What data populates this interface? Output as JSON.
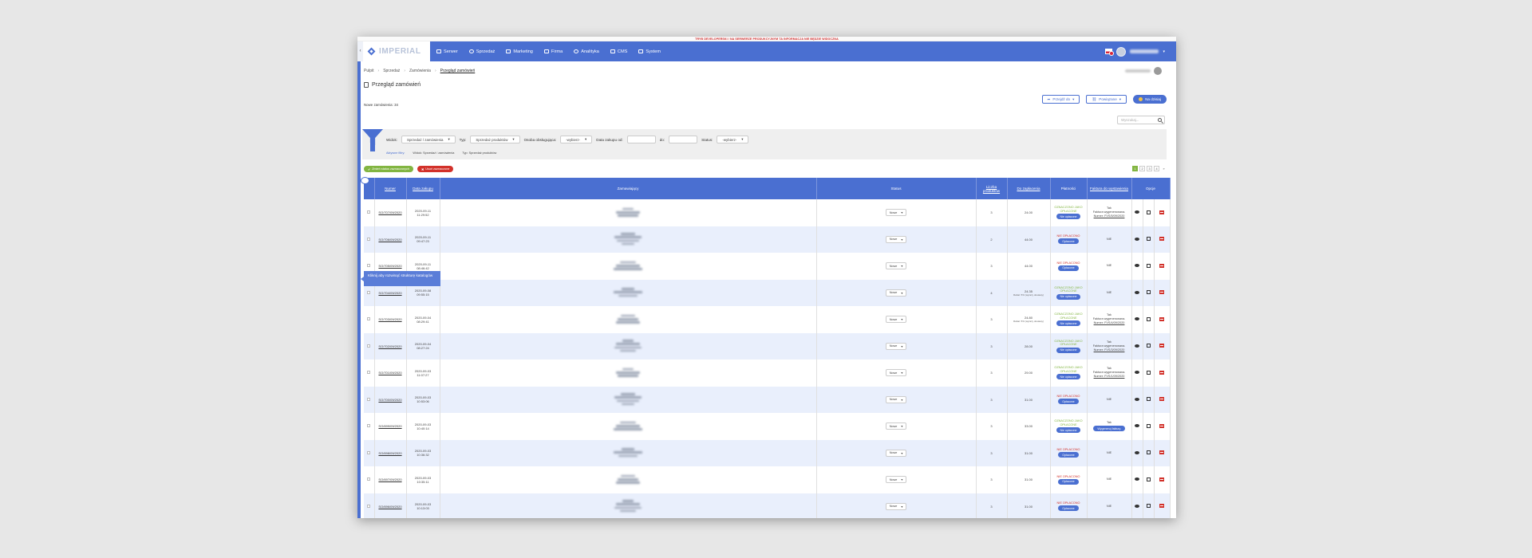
{
  "banner": "TRYB DEVELOPERSKI / NA SERWERZE PRODUKCYJNYM TA INFORMACJA NIE BĘDZIE WIDOCZNA",
  "app": {
    "logo_text": "IMPERIAL"
  },
  "nav": {
    "items": [
      {
        "label": "Serwer",
        "icon": "server-icon"
      },
      {
        "label": "Sprzedaż",
        "icon": "cart-icon"
      },
      {
        "label": "Marketing",
        "icon": "megaphone-icon"
      },
      {
        "label": "Firma",
        "icon": "building-icon"
      },
      {
        "label": "Analityka",
        "icon": "chart-icon"
      },
      {
        "label": "CMS",
        "icon": "cms-icon"
      },
      {
        "label": "System",
        "icon": "system-icon"
      }
    ]
  },
  "breadcrumb": [
    "Pulpit",
    "Sprzedaż",
    "Zamówienia",
    "Przegląd zamówień"
  ],
  "page_title": "Przegląd zamówień",
  "top_buttons": {
    "export": "Przejdź do",
    "group": "Powiązane",
    "new": "Na dzisiaj"
  },
  "new_orders": "Nowe zamówienia: 34",
  "search": {
    "placeholder": "Wyszukaj..."
  },
  "filters": {
    "view_label": "Widok:",
    "view_value": "Sprzedaż / zamówienia",
    "type_label": "Typ:",
    "type_value": "Sprzedaż produktów",
    "handler_label": "Osoba obsługująca:",
    "handler_value": "-wybierz-",
    "date_from_label": "Data zakupu od:",
    "date_to_label": "do:",
    "status_label": "Status:",
    "status_value": "-wybierz-",
    "active_link": "Aktywne filtry:",
    "active_view": "Widok: Sprzedaż / zamówienia",
    "active_type": "Typ: Sprzedaż produktów"
  },
  "actions": {
    "change_status": "Zmień status zaznaczonych",
    "delete": "Usuń zaznaczone"
  },
  "pager": {
    "pages": [
      "1",
      "2",
      "3",
      "4"
    ],
    "next": "»"
  },
  "table": {
    "headers": {
      "number": "Numer",
      "date": "Data zakupu",
      "customer": "Zamawiający",
      "status": "Status",
      "products": "Liczba produktów",
      "to_pay": "Do zapłacenia",
      "payments": "Płatności",
      "invoice": "Faktura do wystawienia",
      "options": "Opcje"
    },
    "rows": [
      {
        "number": "SO/707/09/2020",
        "date": "2020-09-11",
        "time": "11:29:52",
        "status": "Nowe",
        "products": "3",
        "to_pay": "24.00",
        "note": "",
        "pay_status": "OZNACZONO JAKO OPŁACONE",
        "pay_btn": "Nie opłacone",
        "pay_ok": true,
        "invoice": "Tak",
        "invoice_l1": "Faktura wygenerowana.",
        "invoice_num": "Numer: FVS/5/09/2020"
      },
      {
        "number": "SO/706/09/2020",
        "date": "2020-09-11",
        "time": "09:47:23",
        "status": "Nowe",
        "products": "2",
        "to_pay": "44.00",
        "note": "",
        "pay_status": "NIE OPŁACONO",
        "pay_btn": "Opłacone",
        "pay_ok": false,
        "invoice": "NIE",
        "invoice_l1": "",
        "invoice_num": ""
      },
      {
        "number": "SO/705/09/2020",
        "date": "2020-09-11",
        "time": "08:46:42",
        "status": "Nowe",
        "products": "3",
        "to_pay": "44.00",
        "note": "",
        "pay_status": "NIE OPŁACONO",
        "pay_btn": "Opłacone",
        "pay_ok": false,
        "invoice": "NIE",
        "invoice_l1": "",
        "invoice_num": ""
      },
      {
        "number": "SO/704/09/2020",
        "date": "2020-09-08",
        "time": "09:55:15",
        "status": "Nowe",
        "products": "4",
        "to_pay": "24.35",
        "note": "Rabat: 5% (wyrazy dostawy)",
        "pay_status": "OZNACZONO JAKO OPŁACONE",
        "pay_btn": "Nie opłacone",
        "pay_ok": true,
        "invoice": "NIE",
        "invoice_l1": "",
        "invoice_num": ""
      },
      {
        "number": "SO/703/09/2020",
        "date": "2020-09-04",
        "time": "08:29:41",
        "status": "Nowe",
        "products": "3",
        "to_pay": "24.80",
        "note": "Rabat: 5% (wyrazy dostawy)",
        "pay_status": "OZNACZONO JAKO OPŁACONE",
        "pay_btn": "Nie opłacone",
        "pay_ok": true,
        "invoice": "Tak",
        "invoice_l1": "Faktura wygenerowana.",
        "invoice_num": "Numer: FVS/4/09/2020"
      },
      {
        "number": "SO/702/09/2020",
        "date": "2020-09-04",
        "time": "08:27:24",
        "status": "Nowe",
        "products": "3",
        "to_pay": "28.00",
        "note": "",
        "pay_status": "OZNACZONO JAKO OPŁACONE",
        "pay_btn": "Nie opłacone",
        "pay_ok": true,
        "invoice": "Tak",
        "invoice_l1": "Faktura wygenerowana.",
        "invoice_num": "Numer: FVS/3/09/2020"
      },
      {
        "number": "SO/701/09/2020",
        "date": "2020-09-03",
        "time": "11:07:27",
        "status": "Nowe",
        "products": "3",
        "to_pay": "29.00",
        "note": "",
        "pay_status": "OZNACZONO JAKO OPŁACONE",
        "pay_btn": "Nie opłacone",
        "pay_ok": true,
        "invoice": "Tak",
        "invoice_l1": "Faktura wygenerowana.",
        "invoice_num": "Numer: FVS/1/09/2020"
      },
      {
        "number": "SO/700/09/2020",
        "date": "2020-09-03",
        "time": "10:53:06",
        "status": "Nowe",
        "products": "3",
        "to_pay": "31.00",
        "note": "",
        "pay_status": "NIE OPŁACONO",
        "pay_btn": "Opłacone",
        "pay_ok": false,
        "invoice": "NIE",
        "invoice_l1": "",
        "invoice_num": ""
      },
      {
        "number": "SO/699/09/2020",
        "date": "2020-09-03",
        "time": "10:40:14",
        "status": "Nowe",
        "products": "3",
        "to_pay": "33.00",
        "note": "",
        "pay_status": "OZNACZONO JAKO OPŁACONE",
        "pay_btn": "Nie opłacone",
        "pay_ok": true,
        "invoice": "Tak",
        "invoice_l1": "",
        "invoice_num": "",
        "invoice_btn": "Wygeneruj fakturę"
      },
      {
        "number": "SO/698/09/2020",
        "date": "2020-09-03",
        "time": "10:36:32",
        "status": "Nowe",
        "products": "3",
        "to_pay": "31.00",
        "note": "",
        "pay_status": "NIE OPŁACONO",
        "pay_btn": "Opłacone",
        "pay_ok": false,
        "invoice": "NIE",
        "invoice_l1": "",
        "invoice_num": ""
      },
      {
        "number": "SO/697/09/2020",
        "date": "2020-09-03",
        "time": "10:35:11",
        "status": "Nowe",
        "products": "3",
        "to_pay": "31.00",
        "note": "",
        "pay_status": "NIE OPŁACONO",
        "pay_btn": "Opłacone",
        "pay_ok": false,
        "invoice": "NIE",
        "invoice_l1": "",
        "invoice_num": ""
      },
      {
        "number": "SO/696/09/2020",
        "date": "2020-09-03",
        "time": "10:13:03",
        "status": "Nowe",
        "products": "3",
        "to_pay": "31.00",
        "note": "",
        "pay_status": "NIE OPŁACONO",
        "pay_btn": "Opłacone",
        "pay_ok": false,
        "invoice": "NIE",
        "invoice_l1": "",
        "invoice_num": ""
      }
    ]
  },
  "tooltip": "Kliknij aby rozwinąć strukturę katalogów",
  "colors": {
    "brand": "#4a6fd1",
    "green": "#82b541",
    "red": "#d2312a"
  }
}
